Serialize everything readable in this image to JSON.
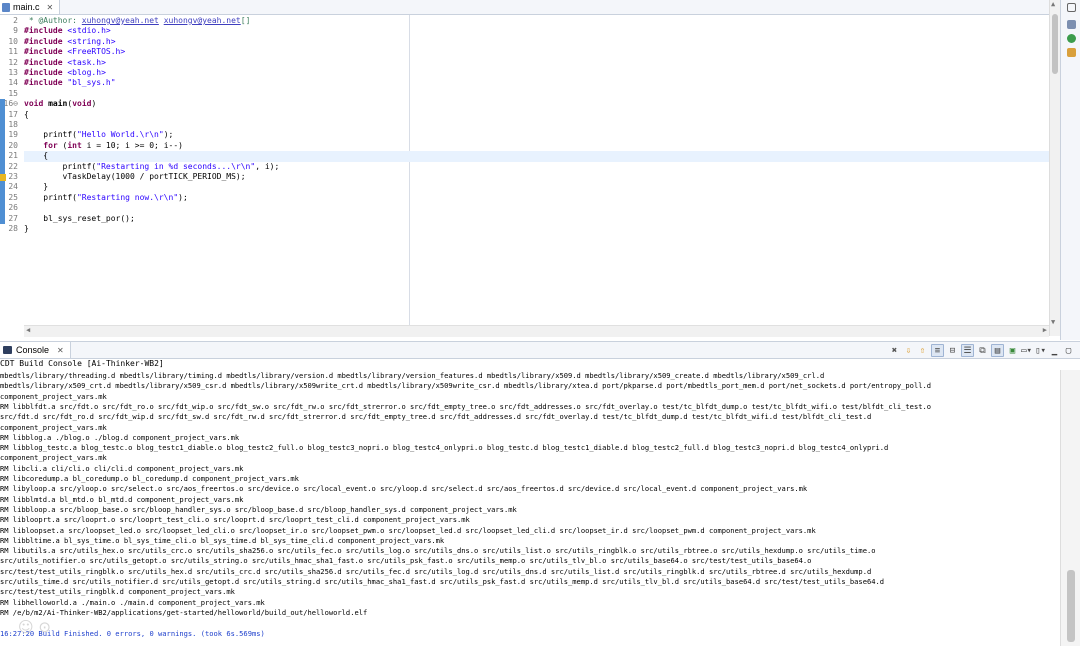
{
  "editor": {
    "tab_label": "main.c",
    "lines": [
      {
        "num": "2",
        "segs": [
          {
            "t": " * @Author: ",
            "c": "cm"
          },
          {
            "t": "xuhongv@yeah.net",
            "c": "link"
          },
          {
            "t": " ",
            "c": "cm"
          },
          {
            "t": "xuhongv@yeah.net",
            "c": "link"
          },
          {
            "t": "[]",
            "c": "cm"
          }
        ]
      },
      {
        "num": "9",
        "segs": [
          {
            "t": "#include",
            "c": "kw"
          },
          {
            "t": " <stdio.h>",
            "c": "str"
          }
        ]
      },
      {
        "num": "10",
        "segs": [
          {
            "t": "#include",
            "c": "kw"
          },
          {
            "t": " <string.h>",
            "c": "str"
          }
        ]
      },
      {
        "num": "11",
        "segs": [
          {
            "t": "#include",
            "c": "kw"
          },
          {
            "t": " <FreeRTOS.h>",
            "c": "str"
          }
        ]
      },
      {
        "num": "12",
        "segs": [
          {
            "t": "#include",
            "c": "kw"
          },
          {
            "t": " <task.h>",
            "c": "str"
          }
        ]
      },
      {
        "num": "13",
        "segs": [
          {
            "t": "#include",
            "c": "kw"
          },
          {
            "t": " <blog.h>",
            "c": "str"
          }
        ]
      },
      {
        "num": "14",
        "segs": [
          {
            "t": "#include",
            "c": "kw"
          },
          {
            "t": " \"bl_sys.h\"",
            "c": "str"
          }
        ]
      },
      {
        "num": "15",
        "segs": []
      },
      {
        "num": "16⊖",
        "segs": [
          {
            "t": "void",
            "c": "kw"
          },
          {
            "t": " ",
            "c": ""
          },
          {
            "t": "main",
            "c": "b"
          },
          {
            "t": "(",
            "c": ""
          },
          {
            "t": "void",
            "c": "kw"
          },
          {
            "t": ")",
            "c": ""
          }
        ]
      },
      {
        "num": "17",
        "segs": [
          {
            "t": "{",
            "c": ""
          }
        ]
      },
      {
        "num": "18",
        "segs": []
      },
      {
        "num": "19",
        "segs": [
          {
            "t": "    printf(",
            "c": ""
          },
          {
            "t": "\"Hello World.\\r\\n\"",
            "c": "str"
          },
          {
            "t": ");",
            "c": ""
          }
        ]
      },
      {
        "num": "20",
        "segs": [
          {
            "t": "    ",
            "c": ""
          },
          {
            "t": "for",
            "c": "kw"
          },
          {
            "t": " (",
            "c": ""
          },
          {
            "t": "int",
            "c": "kw"
          },
          {
            "t": " i = 10; i >= 0; i--)",
            "c": ""
          }
        ]
      },
      {
        "num": "21",
        "segs": [
          {
            "t": "    {",
            "c": ""
          }
        ],
        "hl": true
      },
      {
        "num": "22",
        "segs": [
          {
            "t": "        printf(",
            "c": ""
          },
          {
            "t": "\"Restarting in %d seconds...\\r\\n\"",
            "c": "str"
          },
          {
            "t": ", i);",
            "c": ""
          }
        ]
      },
      {
        "num": "23",
        "segs": [
          {
            "t": "        vTaskDelay(1000 / portTICK_PERIOD_MS);",
            "c": ""
          }
        ]
      },
      {
        "num": "24",
        "segs": [
          {
            "t": "    }",
            "c": ""
          }
        ]
      },
      {
        "num": "25",
        "segs": [
          {
            "t": "    printf(",
            "c": ""
          },
          {
            "t": "\"Restarting now.\\r\\n\"",
            "c": "str"
          },
          {
            "t": ");",
            "c": ""
          }
        ]
      },
      {
        "num": "26",
        "segs": []
      },
      {
        "num": "27",
        "segs": [
          {
            "t": "    bl_sys_reset_por();",
            "c": ""
          }
        ]
      },
      {
        "num": "28",
        "segs": [
          {
            "t": "}",
            "c": ""
          }
        ]
      }
    ]
  },
  "console": {
    "tab_label": "Console",
    "title": "CDT Build Console [Ai-Thinker-WB2]",
    "lines": [
      {
        "t": "mbedtls/library/threading.d mbedtls/library/timing.d mbedtls/library/version.d mbedtls/library/version_features.d mbedtls/library/x509.d mbedtls/library/x509_create.d mbedtls/library/x509_crl.d",
        "c": ""
      },
      {
        "t": "mbedtls/library/x509_crt.d mbedtls/library/x509_csr.d mbedtls/library/x509write_crt.d mbedtls/library/x509write_csr.d mbedtls/library/xtea.d port/pkparse.d port/mbedtls_port_mem.d port/net_sockets.d port/entropy_poll.d",
        "c": ""
      },
      {
        "t": "component_project_vars.mk",
        "c": ""
      },
      {
        "t": "RM libblfdt.a src/fdt.o src/fdt_ro.o src/fdt_wip.o src/fdt_sw.o src/fdt_rw.o src/fdt_strerror.o src/fdt_empty_tree.o src/fdt_addresses.o src/fdt_overlay.o test/tc_blfdt_dump.o test/tc_blfdt_wifi.o test/blfdt_cli_test.o",
        "c": ""
      },
      {
        "t": "src/fdt.d src/fdt_ro.d src/fdt_wip.d src/fdt_sw.d src/fdt_rw.d src/fdt_strerror.d src/fdt_empty_tree.d src/fdt_addresses.d src/fdt_overlay.d test/tc_blfdt_dump.d test/tc_blfdt_wifi.d test/blfdt_cli_test.d",
        "c": ""
      },
      {
        "t": "component_project_vars.mk",
        "c": ""
      },
      {
        "t": "RM libblog.a ./blog.o ./blog.d component_project_vars.mk",
        "c": ""
      },
      {
        "t": "RM libblog_testc.a blog_testc.o blog_testc1_diable.o blog_testc2_full.o blog_testc3_nopri.o blog_testc4_onlypri.o blog_testc.d blog_testc1_diable.d blog_testc2_full.d blog_testc3_nopri.d blog_testc4_onlypri.d",
        "c": ""
      },
      {
        "t": "component_project_vars.mk",
        "c": ""
      },
      {
        "t": "RM libcli.a cli/cli.o cli/cli.d component_project_vars.mk",
        "c": ""
      },
      {
        "t": "RM libcoredump.a bl_coredump.o bl_coredump.d component_project_vars.mk",
        "c": ""
      },
      {
        "t": "RM libyloop.a src/yloop.o src/select.o src/aos_freertos.o src/device.o src/local_event.o src/yloop.d src/select.d src/aos_freertos.d src/device.d src/local_event.d component_project_vars.mk",
        "c": ""
      },
      {
        "t": "RM libblmtd.a bl_mtd.o bl_mtd.d component_project_vars.mk",
        "c": ""
      },
      {
        "t": "RM libbloop.a src/bloop_base.o src/bloop_handler_sys.o src/bloop_base.d src/bloop_handler_sys.d component_project_vars.mk",
        "c": ""
      },
      {
        "t": "RM liblooprt.a src/looprt.o src/looprt_test_cli.o src/looprt.d src/looprt_test_cli.d component_project_vars.mk",
        "c": ""
      },
      {
        "t": "RM libloopset.a src/loopset_led.o src/loopset_led_cli.o src/loopset_ir.o src/loopset_pwm.o src/loopset_led.d src/loopset_led_cli.d src/loopset_ir.d src/loopset_pwm.d component_project_vars.mk",
        "c": ""
      },
      {
        "t": "RM libbltime.a bl_sys_time.o bl_sys_time_cli.o bl_sys_time.d bl_sys_time_cli.d component_project_vars.mk",
        "c": ""
      },
      {
        "t": "RM libutils.a src/utils_hex.o src/utils_crc.o src/utils_sha256.o src/utils_fec.o src/utils_log.o src/utils_dns.o src/utils_list.o src/utils_ringblk.o src/utils_rbtree.o src/utils_hexdump.o src/utils_time.o",
        "c": ""
      },
      {
        "t": "src/utils_notifier.o src/utils_getopt.o src/utils_string.o src/utils_hmac_sha1_fast.o src/utils_psk_fast.o src/utils_memp.o src/utils_tlv_bl.o src/utils_base64.o src/test/test_utils_base64.o",
        "c": ""
      },
      {
        "t": "src/test/test_utils_ringblk.o src/utils_hex.d src/utils_crc.d src/utils_sha256.d src/utils_fec.d src/utils_log.d src/utils_dns.d src/utils_list.d src/utils_ringblk.d src/utils_rbtree.d src/utils_hexdump.d",
        "c": ""
      },
      {
        "t": "src/utils_time.d src/utils_notifier.d src/utils_getopt.d src/utils_string.d src/utils_hmac_sha1_fast.d src/utils_psk_fast.d src/utils_memp.d src/utils_tlv_bl.d src/utils_base64.d src/test/test_utils_base64.d",
        "c": ""
      },
      {
        "t": "src/test/test_utils_ringblk.d component_project_vars.mk",
        "c": ""
      },
      {
        "t": "RM libhelloworld.a ./main.o ./main.d component_project_vars.mk",
        "c": ""
      },
      {
        "t": "RM /e/b/m2/Ai-Thinker-WB2/applications/get-started/helloworld/build_out/helloworld.elf",
        "c": ""
      },
      {
        "t": "",
        "c": ""
      },
      {
        "t": "16:27:20 Build Finished. 0 errors, 0 warnings. (took 6s.569ms)",
        "c": "blue"
      }
    ]
  }
}
